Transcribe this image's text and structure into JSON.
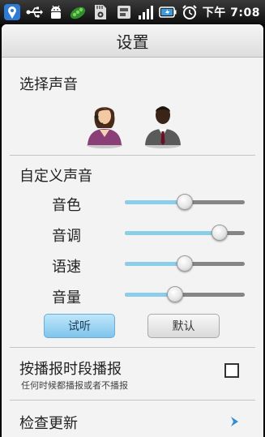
{
  "status_bar": {
    "time_period": "下午",
    "time": "7:08",
    "left_icons": [
      "location-app-icon",
      "usb-icon",
      "android-debug-icon",
      "peas-icon",
      "sd-card-icon"
    ],
    "right_icons": [
      "notification-icon",
      "signal-icon",
      "battery-icon",
      "alarm-icon"
    ]
  },
  "header": {
    "title": "设置"
  },
  "voice_select": {
    "title": "选择声音",
    "options": [
      "female-voice-avatar",
      "male-voice-avatar"
    ]
  },
  "custom_voice": {
    "title": "自定义声音",
    "sliders": [
      {
        "label": "音色",
        "value": 0.5
      },
      {
        "label": "音调",
        "value": 0.79
      },
      {
        "label": "语速",
        "value": 0.5
      },
      {
        "label": "音量",
        "value": 0.42
      }
    ],
    "try_button": "试听",
    "default_button": "默认"
  },
  "schedule": {
    "title": "按播报时段播报",
    "subtitle": "任何时候都播报或者不播报",
    "checked": false
  },
  "update": {
    "title": "检查更新"
  },
  "colors": {
    "accent": "#8ccdea",
    "track": "#858585"
  }
}
